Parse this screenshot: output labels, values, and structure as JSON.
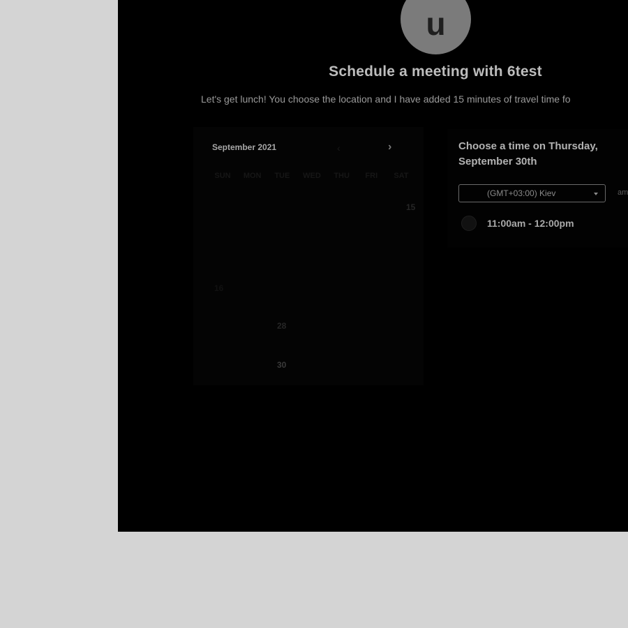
{
  "host": {
    "avatar_letter": "u",
    "title": "Schedule a meeting with 6test",
    "description": "Let's get lunch! You choose the location and I have added 15 minutes of travel time fo"
  },
  "calendar": {
    "month_label": "September 2021",
    "prev_icon": "chevron-left-icon",
    "next_icon": "chevron-right-icon",
    "next_glyph": "›",
    "prev_glyph": "‹",
    "weekdays": [
      "SUN",
      "MON",
      "TUE",
      "WED",
      "THU",
      "FRI",
      "SAT"
    ],
    "days": {
      "d15": "15",
      "d16": "16",
      "d28": "28",
      "d30": "30"
    },
    "selected_date": "30"
  },
  "time_picker": {
    "heading": "Choose a time on Thursday, September 30th",
    "timezone": "(GMT+03:00) Kiev",
    "format_toggle": "am",
    "slots": [
      {
        "label": "11:00am - 12:00pm"
      }
    ]
  },
  "colors": {
    "page_bg": "#d4d4d4",
    "panel_bg": "#000000",
    "avatar_bg": "#7b7b7b"
  }
}
